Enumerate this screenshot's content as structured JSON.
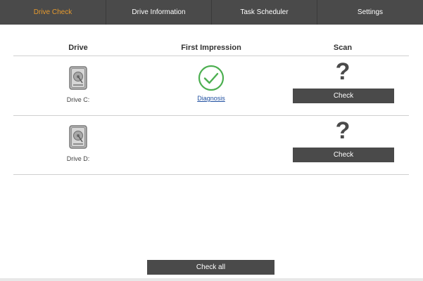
{
  "tabs": [
    {
      "label": "Drive Check",
      "active": true
    },
    {
      "label": "Drive Information",
      "active": false
    },
    {
      "label": "Task Scheduler",
      "active": false
    },
    {
      "label": "Settings",
      "active": false
    }
  ],
  "table": {
    "columns": [
      "Drive",
      "First Impression",
      "Scan"
    ],
    "rows": [
      {
        "drive_label": "Drive C:",
        "drive_icon": "hard-drive-icon",
        "impression_icon": "check-circle-icon",
        "impression_link": "Diagnosis",
        "scan_icon": "question-mark-icon",
        "scan_icon_glyph": "?",
        "check_label": "Check"
      },
      {
        "drive_label": "Drive D:",
        "drive_icon": "hard-drive-icon",
        "scan_icon": "question-mark-icon",
        "scan_icon_glyph": "?",
        "check_label": "Check"
      }
    ]
  },
  "footer": {
    "check_all_label": "Check all"
  },
  "colors": {
    "tabbar_bg": "#4a4a4a",
    "active_tab": "#e69a2e",
    "success_green": "#4caf50",
    "button_bg": "#4a4a4a",
    "link": "#1f4fa0"
  }
}
